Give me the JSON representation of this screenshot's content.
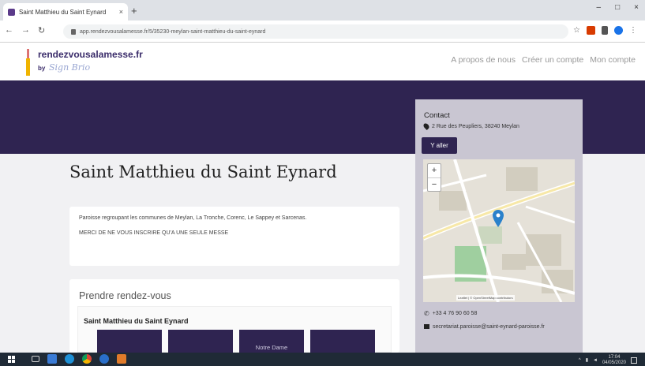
{
  "browser": {
    "tab_title": "Saint Matthieu du Saint Eynard",
    "new_tab": "+",
    "close_tab": "×",
    "url": "app.rendezvousalamesse.fr/5/35230-meylan-saint-matthieu-du-saint-eynard",
    "window_controls": [
      "–",
      "□",
      "×"
    ]
  },
  "site": {
    "logo_text": "rendezvousalamesse.fr",
    "logo_by": "by",
    "logo_signature": "Sign Brio",
    "nav": [
      "A propos de nous",
      "Créer un compte",
      "Mon compte"
    ]
  },
  "church": {
    "title": "Saint Matthieu du Saint Eynard",
    "description": "Paroisse regroupant les communes de Meylan, La Tronche, Corenc, Le Sappey et Sarcenas.",
    "notice": "MERCI DE NE VOUS INSCRIRE QU'A UNE SEULE MESSE"
  },
  "booking": {
    "title": "Prendre rendez-vous",
    "parish": "Saint Matthieu du Saint Eynard",
    "slots": [
      "",
      "",
      "Notre Dame",
      ""
    ]
  },
  "contact": {
    "title": "Contact",
    "address": "2 Rue des Peupliers, 38240 Meylan",
    "goto_button": "Y aller",
    "phone": "+33 4 76 90 60 58",
    "email": "secretariat.paroisse@saint-eynard-paroisse.fr",
    "map_attribution": "Leaflet | © OpenStreetMap contributors"
  },
  "taskbar": {
    "time": "17:04",
    "date": "04/05/2020"
  },
  "colors": {
    "brand": "#2f2451",
    "panel": "#c9c6d2",
    "taskbar": "#1f2a36"
  }
}
